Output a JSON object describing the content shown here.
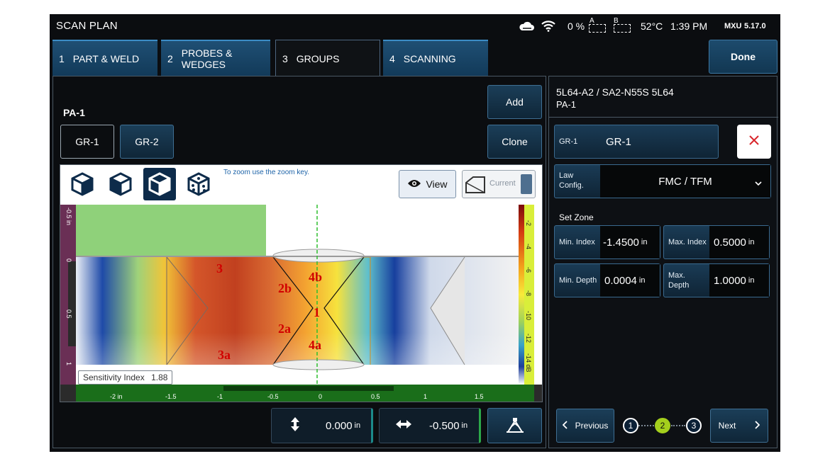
{
  "status_bar": {
    "title": "SCAN PLAN",
    "battery_percent": "0 %",
    "battery_a": "A",
    "battery_b": "B",
    "temperature": "52°C",
    "time": "1:39 PM",
    "product": "MXU",
    "version": "5.17.0"
  },
  "tabs": [
    {
      "num": "1",
      "label": "PART & WELD"
    },
    {
      "num": "2",
      "label": "PROBES & WEDGES"
    },
    {
      "num": "3",
      "label": "GROUPS"
    },
    {
      "num": "4",
      "label": "SCANNING"
    }
  ],
  "done_label": "Done",
  "left": {
    "probe_group": "PA-1",
    "groups": [
      "GR-1",
      "GR-2"
    ],
    "add_label": "Add",
    "clone_label": "Clone",
    "zoom_hint": "To zoom use the zoom key.",
    "view_label": "View",
    "current_label": "Current",
    "sensitivity_label": "Sensitivity Index",
    "sensitivity_value": "1.88",
    "zone_labels": [
      "3",
      "2b",
      "4b",
      "1",
      "2a",
      "4a",
      "3a"
    ],
    "x_ticks": [
      "-2 in",
      "-1.5",
      "-1",
      "-0.5",
      "0",
      "0.5",
      "1",
      "1.5"
    ],
    "y_ticks": [
      "-0.5 in",
      "0",
      "0.5",
      "1"
    ],
    "scale_ticks": [
      "-2",
      "-4",
      "-6",
      "-8",
      "-10",
      "-12",
      "-14 dB"
    ],
    "vertical_offset": "0.000",
    "horizontal_offset": "-0.500",
    "unit": "in"
  },
  "right": {
    "probe_title": "5L64-A2 / SA2-N55S 5L64",
    "probe_group": "PA-1",
    "group_label": "GR-1",
    "group_value": "GR-1",
    "law_label_1": "Law",
    "law_label_2": "Config.",
    "law_value": "FMC / TFM",
    "set_zone": "Set Zone",
    "min_index_label": "Min. Index",
    "min_index_value": "-1.4500",
    "max_index_label": "Max. Index",
    "max_index_value": "0.5000",
    "min_depth_label": "Min. Depth",
    "min_depth_value": "0.0004",
    "max_depth_label_1": "Max.",
    "max_depth_label_2": "Depth",
    "max_depth_value": "1.0000",
    "unit": "in",
    "previous_label": "Previous",
    "next_label": "Next",
    "steps": [
      "1",
      "2",
      "3"
    ],
    "active_step": 2
  },
  "colors": {
    "accent": "#1f4f74",
    "active_step": "#a4cf1d",
    "close_x": "#d9262c",
    "zone_label": "#d10000",
    "part_fill": "#8fd17a",
    "ruler": "#1a6e1a"
  },
  "icons": [
    "cloud-icon",
    "wifi-icon",
    "battery-icon",
    "cube-3d-icon",
    "cube-side-icon",
    "cube-top-icon",
    "cube-dots-icon",
    "eye-icon",
    "vertical-arrow-icon",
    "horizontal-arrow-icon",
    "probe-position-icon",
    "close-icon",
    "chevron-down-icon",
    "chevron-left-icon",
    "chevron-right-icon"
  ]
}
